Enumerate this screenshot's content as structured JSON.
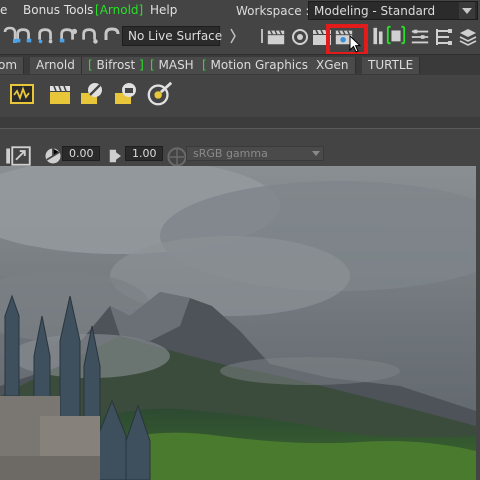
{
  "menu": {
    "items": [
      {
        "label": "e"
      },
      {
        "label": "Bonus Tools"
      },
      {
        "label": "Arnold"
      },
      {
        "label": "Help"
      }
    ]
  },
  "workspace": {
    "label": "Workspace :",
    "value": "Modeling - Standard"
  },
  "statusline": {
    "live_surface": "No Live Surface",
    "icons": [
      "magnet-curve-icon",
      "magnet-grid-icon",
      "magnet-point-icon",
      "magnet-view-icon",
      "magnet-surface-icon",
      "clapper-icon",
      "eye-icon",
      "render-view-icon",
      "render-current-icon",
      "ipr-render-icon",
      "render-settings-icon",
      "hypershade-icon",
      "arnold-render-view-icon",
      "toggle-panels-icon",
      "stack-icon"
    ]
  },
  "shelf_tabs": [
    {
      "label": "om",
      "bracket": false
    },
    {
      "label": "Arnold",
      "bracket": false
    },
    {
      "label": "Bifrost",
      "bracket": true
    },
    {
      "label": "MASH",
      "bracket": true
    },
    {
      "label": "Motion Graphics",
      "bracket": true
    },
    {
      "label": "XGen",
      "bracket": false
    },
    {
      "label": "TURTLE",
      "bracket": false
    }
  ],
  "shelf_icons": [
    "ai-render-view-icon",
    "ai-clapper-icon",
    "ai-light-icon",
    "ai-light-group-icon",
    "ai-standard-surface-icon"
  ],
  "panel": {
    "exposure": "0.00",
    "gamma": "1.00",
    "view_transform": "sRGB gamma"
  },
  "colors": {
    "highlight": "#e31b1b",
    "arnold_green": "#28e028",
    "panel_bg": "#444444"
  }
}
